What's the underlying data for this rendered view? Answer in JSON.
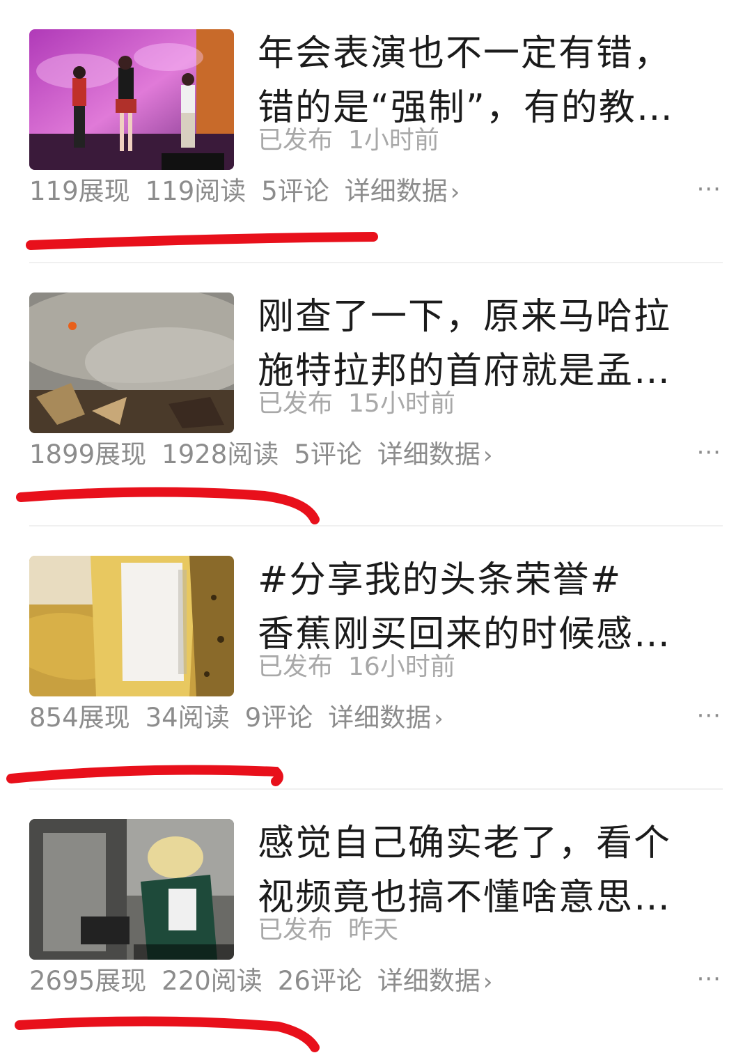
{
  "feed": {
    "items": [
      {
        "title_lines": [
          "年会表演也不一定有错，",
          "错的是“强制”，有的教…"
        ],
        "status": "已发布",
        "time": "1小时前",
        "impressions": "119展现",
        "reads": "119阅读",
        "comments": "5评论",
        "detail_label": "详细数据"
      },
      {
        "title_lines": [
          "刚查了一下，原来马哈拉",
          "施特拉邦的首府就是孟…"
        ],
        "status": "已发布",
        "time": "15小时前",
        "impressions": "1899展现",
        "reads": "1928阅读",
        "comments": "5评论",
        "detail_label": "详细数据"
      },
      {
        "title_lines": [
          "#分享我的头条荣誉#",
          "香蕉刚买回来的时候感…"
        ],
        "status": "已发布",
        "time": "16小时前",
        "impressions": "854展现",
        "reads": "34阅读",
        "comments": "9评论",
        "detail_label": "详细数据"
      },
      {
        "title_lines": [
          "感觉自己确实老了，看个",
          "视频竟也搞不懂啥意思…"
        ],
        "status": "已发布",
        "time": "昨天",
        "impressions": "2695展现",
        "reads": "220阅读",
        "comments": "26评论",
        "detail_label": "详细数据"
      }
    ],
    "chevron": "›",
    "more_glyph": "···",
    "annotation_color": "#e8101b"
  }
}
